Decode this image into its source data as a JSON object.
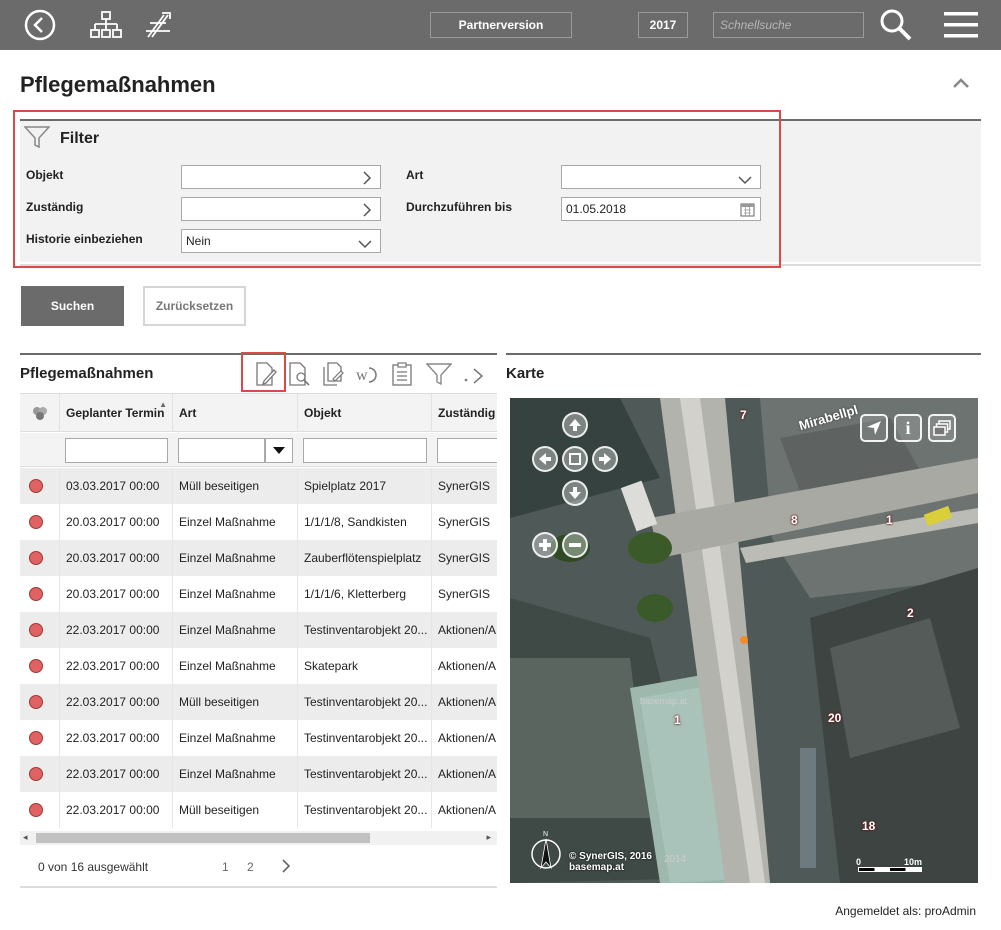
{
  "topbar": {
    "back_icon": "back-circle-icon",
    "sitemap_icon": "sitemap-icon",
    "tools_icon": "tools-icon",
    "partner_label": "Partnerversion",
    "year_label": "2017",
    "search_placeholder": "Schnellsuche",
    "search_icon": "magnifier-icon",
    "menu_icon": "hamburger-menu-icon"
  },
  "page": {
    "title": "Pflegemaßnahmen"
  },
  "filter": {
    "heading": "Filter",
    "fields": {
      "objekt_label": "Objekt",
      "zustaendig_label": "Zuständig",
      "historie_label": "Historie einbeziehen",
      "historie_value": "Nein",
      "art_label": "Art",
      "durchfuehren_label": "Durchzuführen bis",
      "durchfuehren_value": "01.05.2018"
    }
  },
  "actions": {
    "search": "Suchen",
    "reset": "Zurücksetzen"
  },
  "grid": {
    "title": "Pflegemaßnahmen",
    "columns": [
      "Geplanter Termin",
      "Art",
      "Objekt",
      "Zuständig"
    ],
    "rows": [
      [
        "03.03.2017 00:00",
        "Müll beseitigen",
        "Spielplatz 2017",
        "SynerGIS"
      ],
      [
        "20.03.2017 00:00",
        "Einzel Maßnahme",
        "1/1/1/8, Sandkisten",
        "SynerGIS"
      ],
      [
        "20.03.2017 00:00",
        "Einzel Maßnahme",
        "Zauberflötenspielplatz",
        "SynerGIS"
      ],
      [
        "20.03.2017 00:00",
        "Einzel Maßnahme",
        "1/1/1/6, Kletterberg",
        "SynerGIS"
      ],
      [
        "22.03.2017 00:00",
        "Einzel Maßnahme",
        "Testinventarobjekt 20...",
        "Aktionen/A"
      ],
      [
        "22.03.2017 00:00",
        "Einzel Maßnahme",
        "Skatepark",
        "Aktionen/A"
      ],
      [
        "22.03.2017 00:00",
        "Müll beseitigen",
        "Testinventarobjekt 20...",
        "Aktionen/A"
      ],
      [
        "22.03.2017 00:00",
        "Einzel Maßnahme",
        "Testinventarobjekt 20...",
        "Aktionen/A"
      ],
      [
        "22.03.2017 00:00",
        "Einzel Maßnahme",
        "Testinventarobjekt 20...",
        "Aktionen/A"
      ],
      [
        "22.03.2017 00:00",
        "Müll beseitigen",
        "Testinventarobjekt 20...",
        "Aktionen/A"
      ]
    ],
    "selection_text": "0 von 16 ausgewählt",
    "pages": [
      "1",
      "2"
    ],
    "next_icon": "chevron-right-icon"
  },
  "map": {
    "title": "Karte",
    "street_label": "Mirabellpl",
    "copyright_line1": "© SynerGIS, 2016",
    "copyright_line2": "basemap.at",
    "watermark": "basemap.at",
    "scale_start": "0",
    "scale_end": "10m",
    "year_overlay": "2014",
    "numbers": [
      "7",
      "8",
      "1",
      "2",
      "20",
      "1",
      "18"
    ],
    "info_glyph": "i"
  },
  "footer": {
    "logged_in": "Angemeldet als: proAdmin"
  },
  "colors": {
    "topbar": "#6b6b6b",
    "highlight_box": "#d94a4a",
    "status_dot": "#e06262"
  }
}
